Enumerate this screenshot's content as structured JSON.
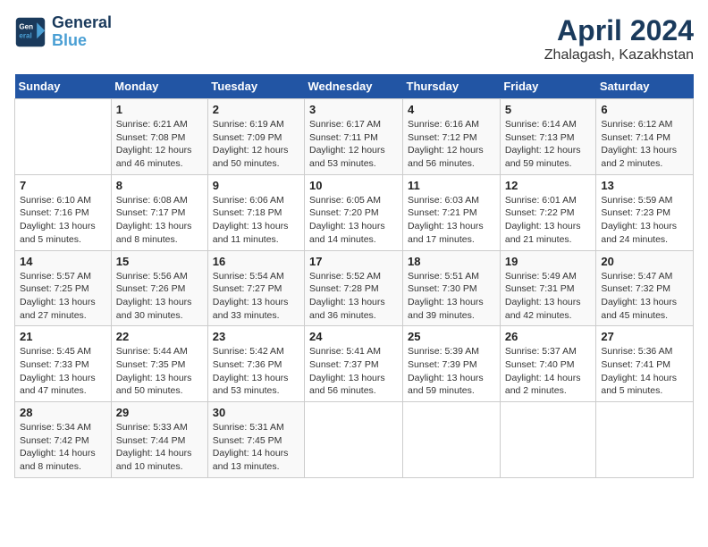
{
  "header": {
    "logo_line1": "General",
    "logo_line2": "Blue",
    "month": "April 2024",
    "location": "Zhalagash, Kazakhstan"
  },
  "weekdays": [
    "Sunday",
    "Monday",
    "Tuesday",
    "Wednesday",
    "Thursday",
    "Friday",
    "Saturday"
  ],
  "weeks": [
    [
      {
        "day": "",
        "info": ""
      },
      {
        "day": "1",
        "info": "Sunrise: 6:21 AM\nSunset: 7:08 PM\nDaylight: 12 hours\nand 46 minutes."
      },
      {
        "day": "2",
        "info": "Sunrise: 6:19 AM\nSunset: 7:09 PM\nDaylight: 12 hours\nand 50 minutes."
      },
      {
        "day": "3",
        "info": "Sunrise: 6:17 AM\nSunset: 7:11 PM\nDaylight: 12 hours\nand 53 minutes."
      },
      {
        "day": "4",
        "info": "Sunrise: 6:16 AM\nSunset: 7:12 PM\nDaylight: 12 hours\nand 56 minutes."
      },
      {
        "day": "5",
        "info": "Sunrise: 6:14 AM\nSunset: 7:13 PM\nDaylight: 12 hours\nand 59 minutes."
      },
      {
        "day": "6",
        "info": "Sunrise: 6:12 AM\nSunset: 7:14 PM\nDaylight: 13 hours\nand 2 minutes."
      }
    ],
    [
      {
        "day": "7",
        "info": "Sunrise: 6:10 AM\nSunset: 7:16 PM\nDaylight: 13 hours\nand 5 minutes."
      },
      {
        "day": "8",
        "info": "Sunrise: 6:08 AM\nSunset: 7:17 PM\nDaylight: 13 hours\nand 8 minutes."
      },
      {
        "day": "9",
        "info": "Sunrise: 6:06 AM\nSunset: 7:18 PM\nDaylight: 13 hours\nand 11 minutes."
      },
      {
        "day": "10",
        "info": "Sunrise: 6:05 AM\nSunset: 7:20 PM\nDaylight: 13 hours\nand 14 minutes."
      },
      {
        "day": "11",
        "info": "Sunrise: 6:03 AM\nSunset: 7:21 PM\nDaylight: 13 hours\nand 17 minutes."
      },
      {
        "day": "12",
        "info": "Sunrise: 6:01 AM\nSunset: 7:22 PM\nDaylight: 13 hours\nand 21 minutes."
      },
      {
        "day": "13",
        "info": "Sunrise: 5:59 AM\nSunset: 7:23 PM\nDaylight: 13 hours\nand 24 minutes."
      }
    ],
    [
      {
        "day": "14",
        "info": "Sunrise: 5:57 AM\nSunset: 7:25 PM\nDaylight: 13 hours\nand 27 minutes."
      },
      {
        "day": "15",
        "info": "Sunrise: 5:56 AM\nSunset: 7:26 PM\nDaylight: 13 hours\nand 30 minutes."
      },
      {
        "day": "16",
        "info": "Sunrise: 5:54 AM\nSunset: 7:27 PM\nDaylight: 13 hours\nand 33 minutes."
      },
      {
        "day": "17",
        "info": "Sunrise: 5:52 AM\nSunset: 7:28 PM\nDaylight: 13 hours\nand 36 minutes."
      },
      {
        "day": "18",
        "info": "Sunrise: 5:51 AM\nSunset: 7:30 PM\nDaylight: 13 hours\nand 39 minutes."
      },
      {
        "day": "19",
        "info": "Sunrise: 5:49 AM\nSunset: 7:31 PM\nDaylight: 13 hours\nand 42 minutes."
      },
      {
        "day": "20",
        "info": "Sunrise: 5:47 AM\nSunset: 7:32 PM\nDaylight: 13 hours\nand 45 minutes."
      }
    ],
    [
      {
        "day": "21",
        "info": "Sunrise: 5:45 AM\nSunset: 7:33 PM\nDaylight: 13 hours\nand 47 minutes."
      },
      {
        "day": "22",
        "info": "Sunrise: 5:44 AM\nSunset: 7:35 PM\nDaylight: 13 hours\nand 50 minutes."
      },
      {
        "day": "23",
        "info": "Sunrise: 5:42 AM\nSunset: 7:36 PM\nDaylight: 13 hours\nand 53 minutes."
      },
      {
        "day": "24",
        "info": "Sunrise: 5:41 AM\nSunset: 7:37 PM\nDaylight: 13 hours\nand 56 minutes."
      },
      {
        "day": "25",
        "info": "Sunrise: 5:39 AM\nSunset: 7:39 PM\nDaylight: 13 hours\nand 59 minutes."
      },
      {
        "day": "26",
        "info": "Sunrise: 5:37 AM\nSunset: 7:40 PM\nDaylight: 14 hours\nand 2 minutes."
      },
      {
        "day": "27",
        "info": "Sunrise: 5:36 AM\nSunset: 7:41 PM\nDaylight: 14 hours\nand 5 minutes."
      }
    ],
    [
      {
        "day": "28",
        "info": "Sunrise: 5:34 AM\nSunset: 7:42 PM\nDaylight: 14 hours\nand 8 minutes."
      },
      {
        "day": "29",
        "info": "Sunrise: 5:33 AM\nSunset: 7:44 PM\nDaylight: 14 hours\nand 10 minutes."
      },
      {
        "day": "30",
        "info": "Sunrise: 5:31 AM\nSunset: 7:45 PM\nDaylight: 14 hours\nand 13 minutes."
      },
      {
        "day": "",
        "info": ""
      },
      {
        "day": "",
        "info": ""
      },
      {
        "day": "",
        "info": ""
      },
      {
        "day": "",
        "info": ""
      }
    ]
  ]
}
